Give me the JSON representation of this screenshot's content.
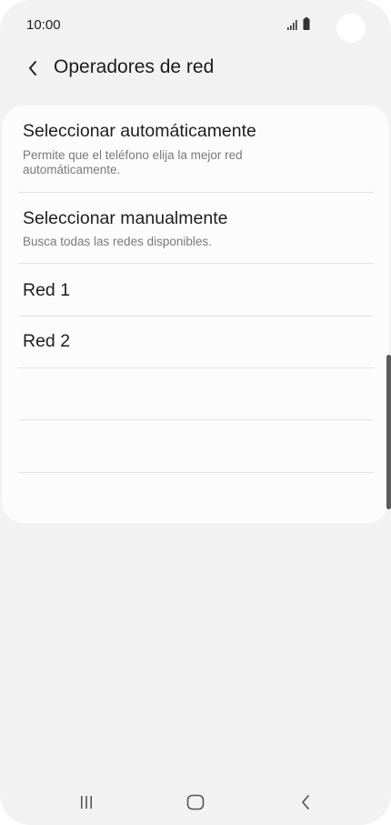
{
  "status_bar": {
    "time": "10:00"
  },
  "header": {
    "title": "Operadores de red",
    "back_icon": "chevron-left-icon"
  },
  "list": {
    "auto": {
      "title": "Seleccionar automáticamente",
      "subtitle_line1": "Permite que el teléfono elija la mejor red",
      "subtitle_line2": "automáticamente."
    },
    "manual": {
      "title": "Seleccionar manualmente",
      "subtitle": "Busca todas las redes disponibles."
    },
    "networks": [
      "Red 1",
      "Red 2",
      "",
      ""
    ]
  },
  "nav_bar": {
    "recents_icon": "recent-apps-icon",
    "home_icon": "home-icon",
    "back_icon": "back-icon"
  },
  "colors": {
    "background": "#f2f2f2",
    "card": "#fcfcfc",
    "primary_text": "#1e1e1e",
    "secondary_text": "#7a7a7a",
    "divider": "#e2e2e2"
  }
}
